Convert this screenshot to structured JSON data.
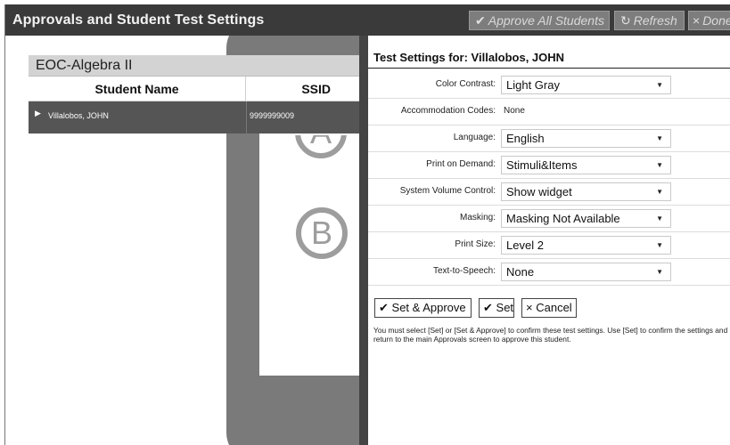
{
  "app": {
    "title": "Approvals and Student Test Settings",
    "buttons": {
      "approve_all": {
        "icon": "✔",
        "label": "Approve All Students"
      },
      "refresh": {
        "icon": "↻",
        "label": "Refresh"
      },
      "done": {
        "icon": "×",
        "label": "Done"
      }
    }
  },
  "background": {
    "answer_choices": [
      "A",
      "B"
    ]
  },
  "students": {
    "test_name": "EOC-Algebra II",
    "columns": {
      "student": "Student Name",
      "ssid": "SSID"
    },
    "rows": [
      {
        "name": "Villalobos, JOHN",
        "ssid": "9999999009"
      }
    ]
  },
  "settings": {
    "title": "Test Settings for: Villalobos, JOHN",
    "rows": [
      {
        "label": "Color Contrast:",
        "value": "Light Gray",
        "type": "select"
      },
      {
        "label": "Accommodation Codes:",
        "value": "None",
        "type": "text"
      },
      {
        "label": "Language:",
        "value": "English",
        "type": "select"
      },
      {
        "label": "Print on Demand:",
        "value": "Stimuli&Items",
        "type": "select"
      },
      {
        "label": "System Volume Control:",
        "value": "Show widget",
        "type": "select"
      },
      {
        "label": "Masking:",
        "value": "Masking Not Available",
        "type": "select"
      },
      {
        "label": "Print Size:",
        "value": "Level 2",
        "type": "select"
      },
      {
        "label": "Text-to-Speech:",
        "value": "None",
        "type": "select"
      }
    ],
    "actions": {
      "set_approve": {
        "icon": "✔",
        "label": "Set & Approve"
      },
      "set": {
        "icon": "✔",
        "label": "Set"
      },
      "cancel": {
        "icon": "×",
        "label": "Cancel"
      }
    },
    "notice": "You must select [Set] or [Set & Approve] to confirm these test settings. Use [Set] to confirm the settings and return to the main Approvals screen to approve this student."
  },
  "colors": {
    "title_bar": "#3a3a3a",
    "selected_row": "#555555",
    "disabled_button": "#7d7d7d"
  }
}
